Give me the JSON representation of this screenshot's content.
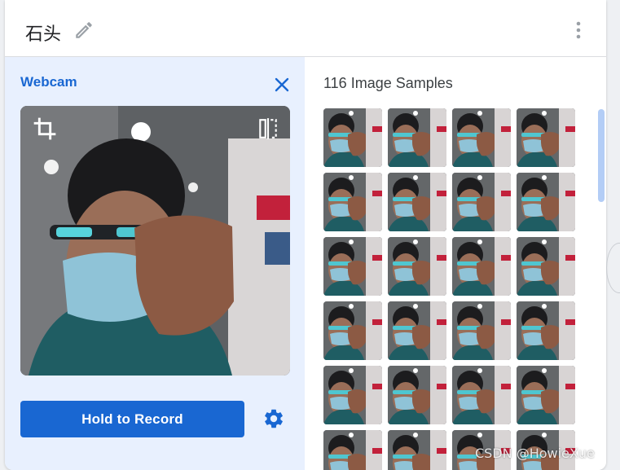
{
  "header": {
    "class_name": "石头",
    "edit_icon": "pencil-icon",
    "more_icon": "more-vert-icon"
  },
  "webcam": {
    "title": "Webcam",
    "close_icon": "close-icon",
    "crop_icon": "crop-icon",
    "flip_icon": "flip-icon",
    "record_label": "Hold to Record",
    "settings_icon": "gear-icon"
  },
  "samples": {
    "title": "116 Image Samples",
    "visible_thumbnails": 24
  },
  "watermark": "CSDN @HowieXue",
  "colors": {
    "accent": "#1967d2",
    "panel_bg": "#e8f0fe",
    "scroll_thumb": "#b3cdf6"
  }
}
